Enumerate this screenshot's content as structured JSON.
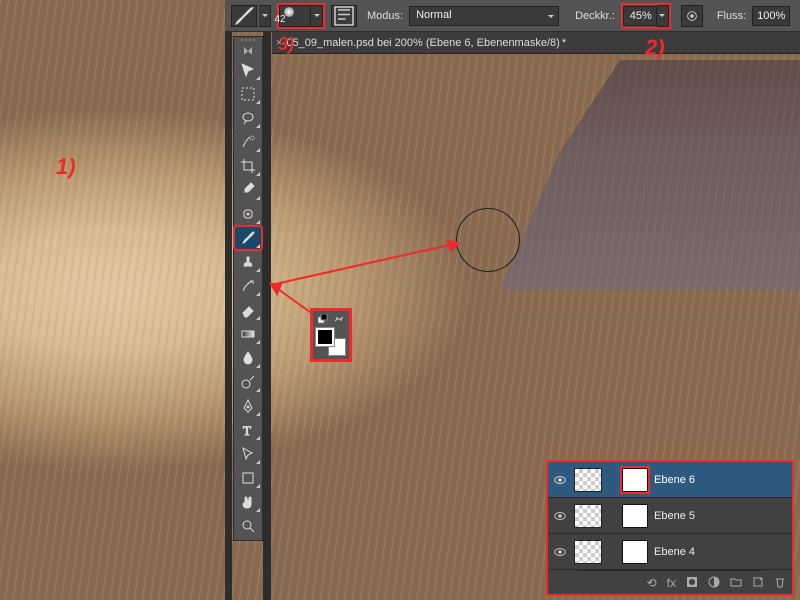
{
  "optionsBar": {
    "brushSize": "42",
    "modusLabel": "Modus:",
    "modusValue": "Normal",
    "opacityLabel": "Deckkr.:",
    "opacityValue": "45%",
    "flowLabel": "Fluss:",
    "flowValue": "100%"
  },
  "documentTab": {
    "closeGlyph": "×",
    "title": "05_09_malen.psd bei 200% (Ebene 6, Ebenenmaske/8)",
    "dirty": "*"
  },
  "annotations": {
    "one": "1)",
    "two": "2)",
    "three": "3)"
  },
  "layers": {
    "items": [
      {
        "name": "Ebene 6",
        "selected": true,
        "maskHighlighted": true
      },
      {
        "name": "Ebene 5",
        "selected": false,
        "maskHighlighted": false
      },
      {
        "name": "Ebene 4",
        "selected": false,
        "maskHighlighted": false
      }
    ],
    "footer": {
      "fx": "fx"
    }
  },
  "colors": {
    "annotation": "#ef2a2a",
    "foreground": "#000000",
    "background": "#ffffff"
  }
}
